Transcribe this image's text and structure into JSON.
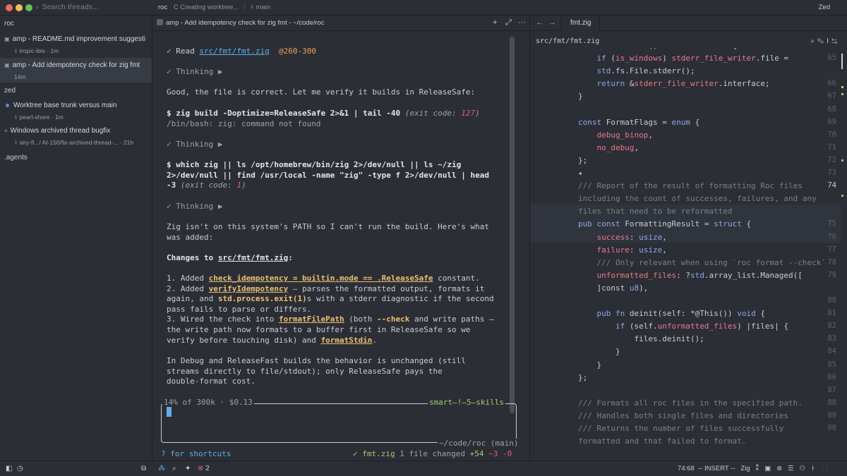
{
  "titlebar": {
    "search_placeholder": "Search threads...",
    "project": "roc",
    "status": "Creating worktree...",
    "branch_icon": "branch-icon",
    "branch": "main",
    "user": "Zed"
  },
  "sidebar": {
    "groups": [
      {
        "name": "roc",
        "threads": [
          {
            "title": "amp - README.md improvement suggesti",
            "worktree": "tropic-ibis",
            "age": "1m"
          },
          {
            "title": "amp - Add idempotency check for zig fmt",
            "worktree": "",
            "age": "14m"
          }
        ]
      },
      {
        "name": "zed",
        "threads": [
          {
            "title": "Worktree base trunk versus main",
            "worktree": "pearl-shore",
            "age": "1m"
          },
          {
            "title": "Windows archived thread bugfix",
            "worktree": "airy-fl.../ AI-150/fix-archived-thread-...",
            "age": "21h"
          }
        ]
      },
      {
        "name": ".agents",
        "threads": []
      }
    ]
  },
  "agent": {
    "tab_title": "amp - Add idempotency check for zig fmt - ~/code/roc",
    "toolbar": {
      "new": "+",
      "expand": "⤢",
      "more": "···"
    },
    "read": {
      "label": "Read",
      "file": "src/fmt/fmt.zig",
      "range": "@260-300"
    },
    "thinking": "Thinking ▶",
    "msg1": "Good, the file is correct. Let me verify it builds in ReleaseSafe:",
    "cmd1": "zig build -Doptimize=ReleaseSafe 2>&1 | tail -40",
    "cmd1_exit_label": "exit code:",
    "cmd1_exit": "127",
    "cmd1_output": "/bin/bash: zig: command not found",
    "cmd2_line1": "which zig || ls /opt/homebrew/bin/zig 2>/dev/null || ls ~/zig",
    "cmd2_line2": "2>/dev/null || find /usr/local -name \"zig\" -type f 2>/dev/null | head",
    "cmd2_line3": "-3",
    "cmd2_exit_label": "exit code:",
    "cmd2_exit": "1",
    "msg2_line1": "Zig isn't on this system's PATH so I can't run the build. Here's what",
    "msg2_line2": "was added:",
    "changes_label": "Changes to",
    "changes_file": "src/fmt/fmt.zig",
    "item1_prefix": "1. Added",
    "item1_code1": "check_idempotency = builtin.mode == .ReleaseSafe",
    "item1_suffix": "constant.",
    "item2_prefix": "2. Added",
    "item2_code1": "verifyIdempotency",
    "item2_mid": "— parses the formatted output, formats it",
    "item2_line2a": "again, and",
    "item2_code2": "std.process.exit(1)",
    "item2_line2b": "s with a stderr diagnostic if the second",
    "item2_line3": "pass fails to parse or differs.",
    "item3_prefix": "3. Wired the check into",
    "item3_code1": "formatFilePath",
    "item3_mid": "(both",
    "item3_code2": "--check",
    "item3_tail": "and write paths —",
    "item3_line2": "the write path now formats to a buffer first in ReleaseSafe so we",
    "item3_line3a": "verify before touching disk) and",
    "item3_code3": "formatStdin",
    "item3_line3b": ".",
    "msg3_line1": "In Debug and ReleaseFast builds the behavior is unchanged (still",
    "msg3_line2": "streams directly to file/stdout); only ReleaseSafe pays the",
    "msg3_line3": "double-format cost.",
    "usage": "14% of 300k · $0.13",
    "mode_skills": "smart—!—5—skills",
    "cwd": "~/code/roc (main)",
    "shortcuts_hint": "? for shortcuts",
    "file_changed_name": "✓ fmt.zig",
    "file_changed_label": "1 file changed",
    "additions": "+54",
    "deletions": "~3",
    "removed": "-0"
  },
  "editor": {
    "tab": "fmt.zig",
    "breadcrumb": "src/fmt/fmt.zig",
    "tools": [
      "⌕",
      "✎",
      "I",
      "⇆"
    ],
    "lines": [
      {
        "n": "64",
        "text": "fn stderrWriter() *std.io.Writer {"
      },
      {
        "n": "65",
        "text": "    if (is_windows) stderr_file_writer.file ="
      },
      {
        "n": "",
        "text": "    std.fs.File.stderr();"
      },
      {
        "n": "66",
        "text": "    return &stderr_file_writer.interface;"
      },
      {
        "n": "67",
        "text": "}"
      },
      {
        "n": "68",
        "text": ""
      },
      {
        "n": "69",
        "text": "const FormatFlags = enum {"
      },
      {
        "n": "70",
        "text": "    debug_binop,"
      },
      {
        "n": "71",
        "text": "    no_debug,"
      },
      {
        "n": "72",
        "text": "};"
      },
      {
        "n": "73",
        "text": "✦"
      },
      {
        "n": "74",
        "text": "/// Report of the result of formatting Roc files"
      },
      {
        "n": "",
        "text": "including the count of successes, failures, and any"
      },
      {
        "n": "",
        "text": "files that need to be reformatted"
      },
      {
        "n": "75",
        "text": "pub const FormattingResult = struct {"
      },
      {
        "n": "76",
        "text": "    success: usize,"
      },
      {
        "n": "77",
        "text": "    failure: usize,"
      },
      {
        "n": "78",
        "text": "    /// Only relevant when using `roc format --check`"
      },
      {
        "n": "79",
        "text": "    unformatted_files: ?std.array_list.Managed(["
      },
      {
        "n": "",
        "text": "    ]const u8),"
      },
      {
        "n": "80",
        "text": ""
      },
      {
        "n": "81",
        "text": "    pub fn deinit(self: *@This()) void {"
      },
      {
        "n": "82",
        "text": "        if (self.unformatted_files) |files| {"
      },
      {
        "n": "83",
        "text": "            files.deinit();"
      },
      {
        "n": "84",
        "text": "        }"
      },
      {
        "n": "85",
        "text": "    }"
      },
      {
        "n": "86",
        "text": "};"
      },
      {
        "n": "87",
        "text": ""
      },
      {
        "n": "88",
        "text": "/// Formats all roc files in the specified path."
      },
      {
        "n": "89",
        "text": "/// Handles both single files and directories"
      },
      {
        "n": "90",
        "text": "/// Returns the number of files successfully"
      },
      {
        "n": "",
        "text": "formatted and that failed to format."
      }
    ]
  },
  "statusbar": {
    "cursor_pos": "74:68",
    "mode": "-- INSERT --",
    "language": "Zig",
    "diagnostics_count": "2"
  },
  "colors": {
    "background": "#2b2e35",
    "accent": "#5ab0e8",
    "success": "#a6cc70",
    "warning": "#e8a555",
    "error": "#e85a6a"
  }
}
